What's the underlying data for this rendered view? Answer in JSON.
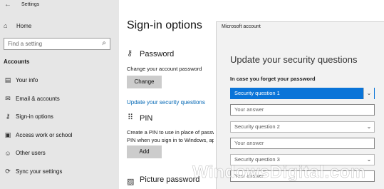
{
  "window": {
    "title": "Settings",
    "back_icon": "back-arrow-icon"
  },
  "sidebar": {
    "home_label": "Home",
    "search_placeholder": "Find a setting",
    "section_heading": "Accounts",
    "items": [
      {
        "label": "Your info",
        "icon": "person-card-icon"
      },
      {
        "label": "Email & accounts",
        "icon": "envelope-icon"
      },
      {
        "label": "Sign-in options",
        "icon": "key-icon"
      },
      {
        "label": "Access work or school",
        "icon": "briefcase-icon"
      },
      {
        "label": "Other users",
        "icon": "user-add-icon"
      },
      {
        "label": "Sync your settings",
        "icon": "sync-icon"
      }
    ]
  },
  "main": {
    "title": "Sign-in options",
    "password": {
      "heading": "Password",
      "description": "Change your account password",
      "button": "Change",
      "link": "Update your security questions"
    },
    "pin": {
      "heading": "PIN",
      "description_line1": "Create a PIN to use in place of passwords.",
      "description_line2": "PIN when you sign in to Windows, apps, and services.",
      "button": "Add"
    },
    "picture_password": {
      "heading": "Picture password"
    }
  },
  "dialog": {
    "title": "Microsoft account",
    "heading": "Update your security questions",
    "subheading": "In case you forget your password",
    "fields": [
      {
        "kind": "select",
        "text": "Security question 1",
        "active": true
      },
      {
        "kind": "answer",
        "text": "Your answer"
      },
      {
        "kind": "select",
        "text": "Security question 2"
      },
      {
        "kind": "answer",
        "text": "Your answer"
      },
      {
        "kind": "select",
        "text": "Security question 3"
      },
      {
        "kind": "answer",
        "text": "Your answer"
      }
    ]
  },
  "watermark": "WindowsDigital.com",
  "colors": {
    "sidebar_bg": "#e6e6e6",
    "accent": "#0a74d8",
    "link": "#0066b4",
    "button_bg": "#cccccc",
    "dialog_bg": "#f2f2f2"
  }
}
